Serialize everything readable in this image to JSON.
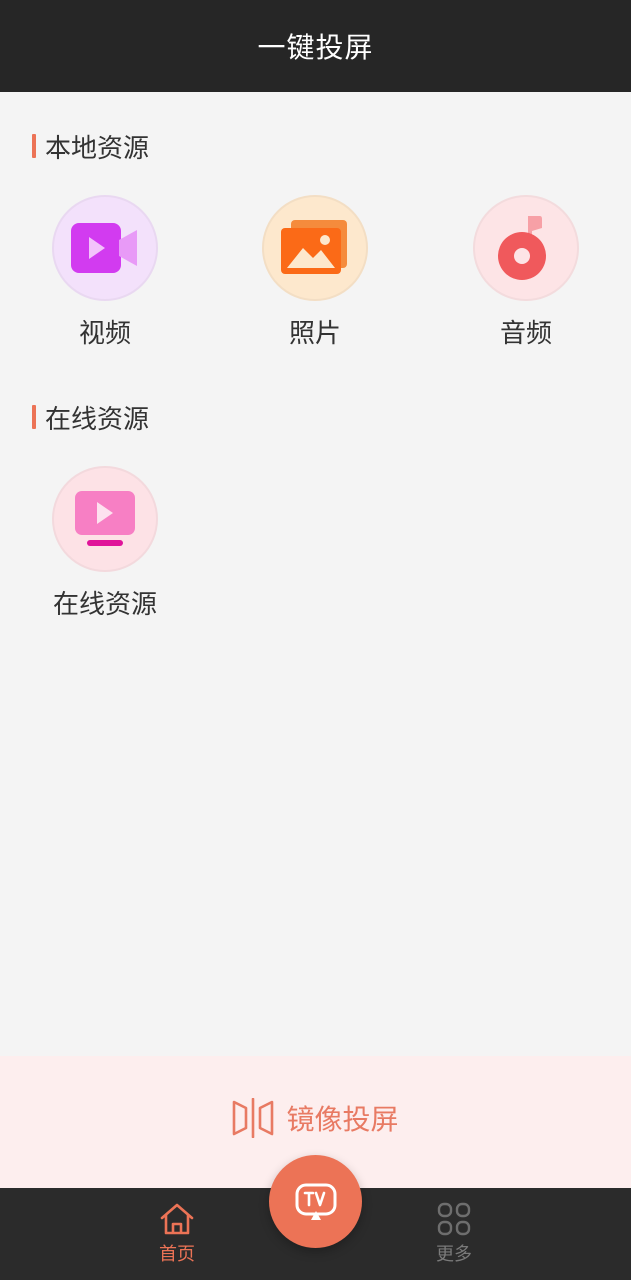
{
  "header": {
    "title": "一键投屏"
  },
  "sections": {
    "local": {
      "title": "本地资源",
      "items": [
        {
          "label": "视频",
          "icon": "video-camera-icon"
        },
        {
          "label": "照片",
          "icon": "photo-gallery-icon"
        },
        {
          "label": "音频",
          "icon": "music-note-icon"
        }
      ]
    },
    "online": {
      "title": "在线资源",
      "items": [
        {
          "label": "在线资源",
          "icon": "online-video-tv-icon"
        }
      ]
    }
  },
  "mirror": {
    "label": "镜像投屏",
    "icon": "mirror-screen-icon"
  },
  "nav": {
    "home": {
      "label": "首页",
      "icon": "home-icon"
    },
    "cast": {
      "icon": "tv-cast-icon"
    },
    "more": {
      "label": "更多",
      "icon": "grid-more-icon"
    }
  },
  "colors": {
    "accent": "#ec7356",
    "header_bg": "#262626",
    "nav_bg": "#2b2b2b",
    "page_bg": "#f4f4f4",
    "mirror_bg": "#fdeeee"
  }
}
